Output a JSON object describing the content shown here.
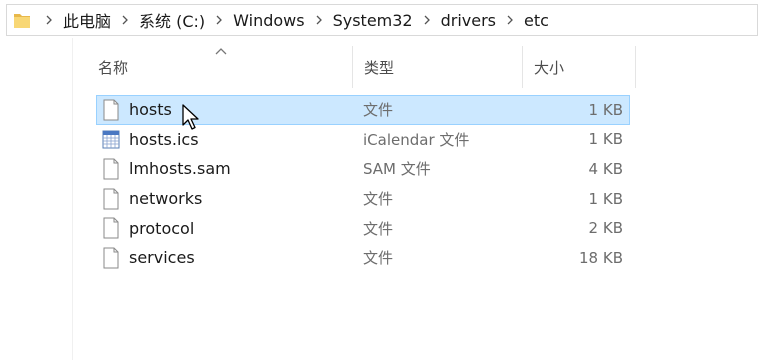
{
  "address_bar": {
    "folder_icon": "folder-icon",
    "separator_icon": "chevron-right-icon",
    "crumbs": [
      "此电脑",
      "系统 (C:)",
      "Windows",
      "System32",
      "drivers",
      "etc"
    ]
  },
  "columns": {
    "name": "名称",
    "type": "类型",
    "size": "大小",
    "sort_icon": "sort-ascending-icon"
  },
  "files": [
    {
      "name": "hosts",
      "type": "文件",
      "size": "1 KB",
      "icon": "file-icon",
      "selected": true
    },
    {
      "name": "hosts.ics",
      "type": "iCalendar 文件",
      "size": "1 KB",
      "icon": "calendar-file-icon",
      "selected": false
    },
    {
      "name": "lmhosts.sam",
      "type": "SAM 文件",
      "size": "4 KB",
      "icon": "file-icon",
      "selected": false
    },
    {
      "name": "networks",
      "type": "文件",
      "size": "1 KB",
      "icon": "file-icon",
      "selected": false
    },
    {
      "name": "protocol",
      "type": "文件",
      "size": "2 KB",
      "icon": "file-icon",
      "selected": false
    },
    {
      "name": "services",
      "type": "文件",
      "size": "18 KB",
      "icon": "file-icon",
      "selected": false
    }
  ],
  "colors": {
    "selection_fill": "#cce8ff",
    "selection_border": "#99d1ff",
    "folder_yellow": "#f8d775"
  }
}
